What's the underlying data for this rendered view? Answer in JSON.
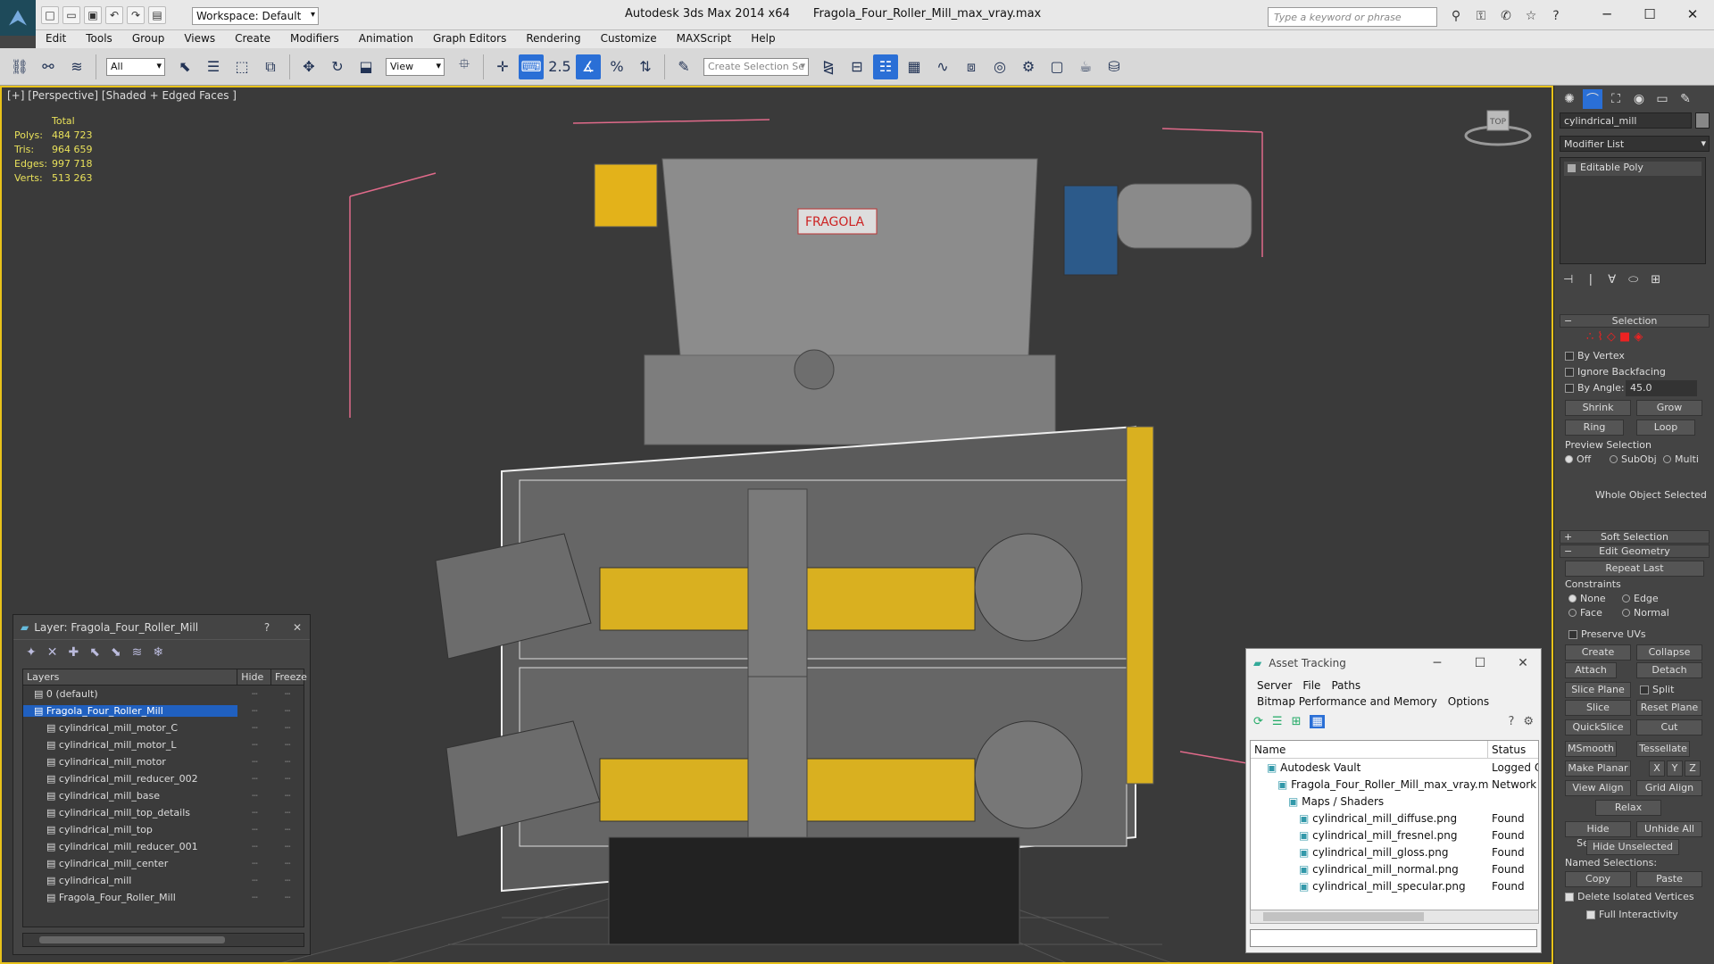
{
  "app": {
    "title": "Autodesk 3ds Max  2014 x64",
    "file": "Fragola_Four_Roller_Mill_max_vray.max",
    "workspace": "Workspace: Default",
    "search_placeholder": "Type a keyword or phrase"
  },
  "menu": [
    "Edit",
    "Tools",
    "Group",
    "Views",
    "Create",
    "Modifiers",
    "Animation",
    "Graph Editors",
    "Rendering",
    "Customize",
    "MAXScript",
    "Help"
  ],
  "toolbar": {
    "filter": "All",
    "ref_coord": "View",
    "snap_value": "2.5",
    "selection_set_placeholder": "Create Selection Se"
  },
  "viewport": {
    "label": "[+] [Perspective] [Shaded + Edged Faces ]",
    "stats_header": "Total",
    "stats": [
      {
        "k": "Polys:",
        "v": "484 723"
      },
      {
        "k": "Tris:",
        "v": "964 659"
      },
      {
        "k": "Edges:",
        "v": "997 718"
      },
      {
        "k": "Verts:",
        "v": "513 263"
      }
    ],
    "brand": "FRAGOLA",
    "gizmo_label": "TOP"
  },
  "layer_window": {
    "title": "Layer: Fragola_Four_Roller_Mill",
    "help": "?",
    "close": "✕",
    "cols": [
      "Layers",
      "Hide",
      "Freeze"
    ],
    "rows": [
      {
        "name": "0 (default)",
        "indent": 1
      },
      {
        "name": "Fragola_Four_Roller_Mill",
        "indent": 1,
        "selected": true
      },
      {
        "name": "cylindrical_mill_motor_C",
        "indent": 2
      },
      {
        "name": "cylindrical_mill_motor_L",
        "indent": 2
      },
      {
        "name": "cylindrical_mill_motor",
        "indent": 2
      },
      {
        "name": "cylindrical_mill_reducer_002",
        "indent": 2
      },
      {
        "name": "cylindrical_mill_base",
        "indent": 2
      },
      {
        "name": "cylindrical_mill_top_details",
        "indent": 2
      },
      {
        "name": "cylindrical_mill_top",
        "indent": 2
      },
      {
        "name": "cylindrical_mill_reducer_001",
        "indent": 2
      },
      {
        "name": "cylindrical_mill_center",
        "indent": 2
      },
      {
        "name": "cylindrical_mill",
        "indent": 2
      },
      {
        "name": "Fragola_Four_Roller_Mill",
        "indent": 2
      }
    ]
  },
  "asset_window": {
    "title": "Asset Tracking",
    "menu": [
      "Server",
      "File",
      "Paths",
      "Bitmap Performance and Memory",
      "Options"
    ],
    "cols": [
      "Name",
      "Status"
    ],
    "rows": [
      {
        "name": "Autodesk Vault",
        "status": "Logged O",
        "indent": 1
      },
      {
        "name": "Fragola_Four_Roller_Mill_max_vray.max",
        "status": "Network",
        "indent": 2
      },
      {
        "name": "Maps / Shaders",
        "status": "",
        "indent": 3
      },
      {
        "name": "cylindrical_mill_diffuse.png",
        "status": "Found",
        "indent": 4
      },
      {
        "name": "cylindrical_mill_fresnel.png",
        "status": "Found",
        "indent": 4
      },
      {
        "name": "cylindrical_mill_gloss.png",
        "status": "Found",
        "indent": 4
      },
      {
        "name": "cylindrical_mill_normal.png",
        "status": "Found",
        "indent": 4
      },
      {
        "name": "cylindrical_mill_specular.png",
        "status": "Found",
        "indent": 4
      }
    ]
  },
  "command_panel": {
    "object_name": "cylindrical_mill",
    "modifier_list": "Modifier List",
    "stack_item": "Editable Poly",
    "selection": {
      "title": "Selection",
      "by_vertex": "By Vertex",
      "ignore_backfacing": "Ignore Backfacing",
      "by_angle": "By Angle:",
      "angle_value": "45.0",
      "shrink": "Shrink",
      "grow": "Grow",
      "ring": "Ring",
      "loop": "Loop",
      "preview_selection": "Preview Selection",
      "off": "Off",
      "subobj": "SubObj",
      "multi": "Multi",
      "whole_object": "Whole Object Selected"
    },
    "soft_selection": "Soft Selection",
    "edit_geometry": {
      "title": "Edit Geometry",
      "repeat_last": "Repeat Last",
      "constraints": "Constraints",
      "none": "None",
      "edge": "Edge",
      "face": "Face",
      "normal": "Normal",
      "preserve_uvs": "Preserve UVs",
      "create": "Create",
      "collapse": "Collapse",
      "attach": "Attach",
      "detach": "Detach",
      "slice_plane": "Slice Plane",
      "split": "Split",
      "slice": "Slice",
      "reset_plane": "Reset Plane",
      "quickslice": "QuickSlice",
      "cut": "Cut",
      "msmooth": "MSmooth",
      "tessellate": "Tessellate",
      "make_planar": "Make Planar",
      "x": "X",
      "y": "Y",
      "z": "Z",
      "view_align": "View Align",
      "grid_align": "Grid Align",
      "relax": "Relax",
      "hide_selected": "Hide Selected",
      "unhide_all": "Unhide All",
      "hide_unselected": "Hide Unselected",
      "named_selections": "Named Selections:",
      "copy": "Copy",
      "paste": "Paste",
      "delete_isolated": "Delete Isolated Vertices",
      "full_interactivity": "Full Interactivity"
    }
  }
}
